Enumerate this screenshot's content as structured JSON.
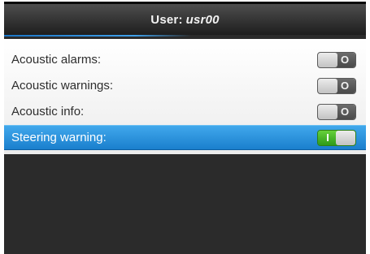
{
  "header": {
    "prefix": "User:",
    "user": "usr00"
  },
  "settings": [
    {
      "label": "Acoustic alarms:",
      "state": "off",
      "symbol": "O",
      "selected": false
    },
    {
      "label": "Acoustic warnings:",
      "state": "off",
      "symbol": "O",
      "selected": false
    },
    {
      "label": "Acoustic info:",
      "state": "off",
      "symbol": "O",
      "selected": false
    },
    {
      "label": "Steering warning:",
      "state": "on",
      "symbol": "I",
      "selected": true
    }
  ],
  "colors": {
    "accent": "#2a8fdc",
    "toggle_on": "#4bb82a",
    "toggle_off": "#5a5a5a"
  }
}
